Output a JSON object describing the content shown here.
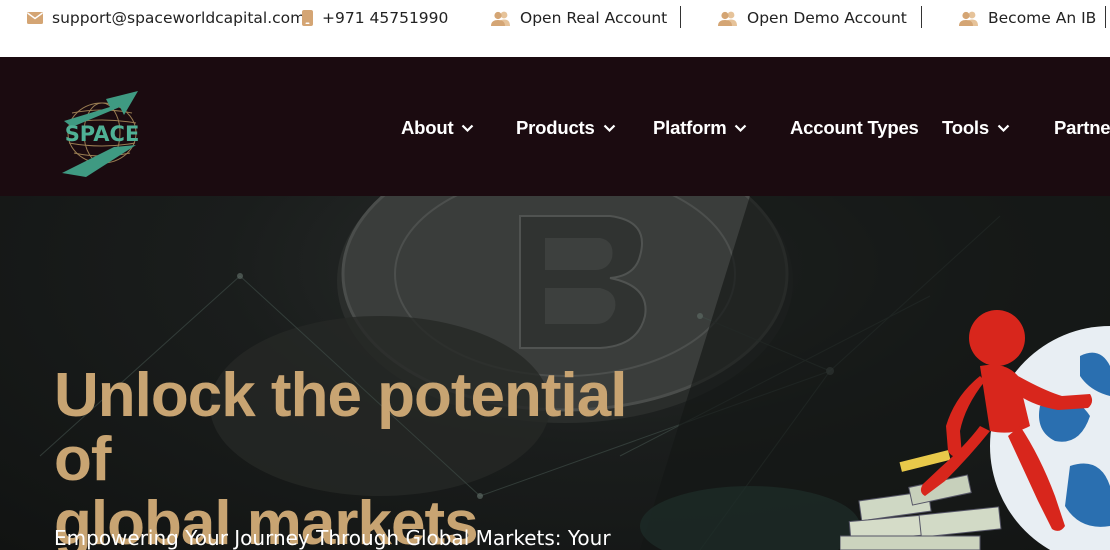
{
  "topbar": {
    "email": "support@spaceworldcapital.com",
    "phone": "+971 45751990",
    "links": [
      {
        "label": "Open Real Account"
      },
      {
        "label": "Open Demo Account"
      },
      {
        "label": "Become An IB"
      }
    ]
  },
  "logo": {
    "text": "SPACE"
  },
  "nav": {
    "items": [
      {
        "label": "About",
        "has_dropdown": true
      },
      {
        "label": "Products",
        "has_dropdown": true
      },
      {
        "label": "Platform",
        "has_dropdown": true
      },
      {
        "label": "Account Types",
        "has_dropdown": false
      },
      {
        "label": "Tools",
        "has_dropdown": true
      },
      {
        "label": "Partner",
        "has_dropdown": false
      }
    ]
  },
  "hero": {
    "title_line1": "Unlock the potential of",
    "title_line2": "global markets",
    "subtitle": "Empowering Your Journey Through Global Markets: Your"
  },
  "colors": {
    "topbar_bg": "#ffffff",
    "nav_bg": "#1b0b10",
    "accent_gold": "#c8a472",
    "icon_tan": "#d4a574",
    "logo_teal": "#3f9a82",
    "figure_red": "#d8261c"
  },
  "icons": {
    "email": "envelope-icon",
    "phone": "phone-icon",
    "account": "users-icon",
    "dropdown": "chevron-down-icon"
  }
}
